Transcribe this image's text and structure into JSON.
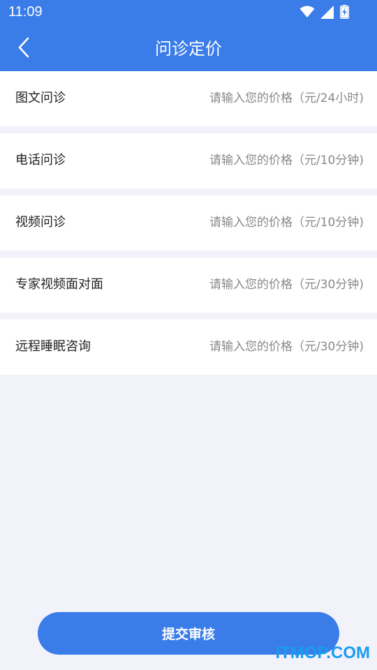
{
  "status_bar": {
    "time": "11:09",
    "icons": [
      "wifi-icon",
      "signal-icon",
      "battery-charging-icon"
    ]
  },
  "header": {
    "title": "问诊定价",
    "back_icon": "chevron-left-icon"
  },
  "price_rows": [
    {
      "label": "图文问诊",
      "placeholder": "请输入您的价格（元/24小时)",
      "value": ""
    },
    {
      "label": "电话问诊",
      "placeholder": "请输入您的价格（元/10分钟)",
      "value": ""
    },
    {
      "label": "视频问诊",
      "placeholder": "请输入您的价格（元/10分钟)",
      "value": ""
    },
    {
      "label": "专家视频面对面",
      "placeholder": "请输入您的价格（元/30分钟)",
      "value": ""
    },
    {
      "label": "远程睡眠咨询",
      "placeholder": "请输入您的价格（元/30分钟)",
      "value": ""
    }
  ],
  "submit": {
    "label": "提交审核"
  },
  "watermark": "ITMOP.COM",
  "colors": {
    "primary": "#3a7ce8",
    "background": "#f2f2fa",
    "row_background": "#ffffff",
    "label_text": "#222222",
    "placeholder_text": "#888888",
    "watermark": "#1a9cf0"
  }
}
